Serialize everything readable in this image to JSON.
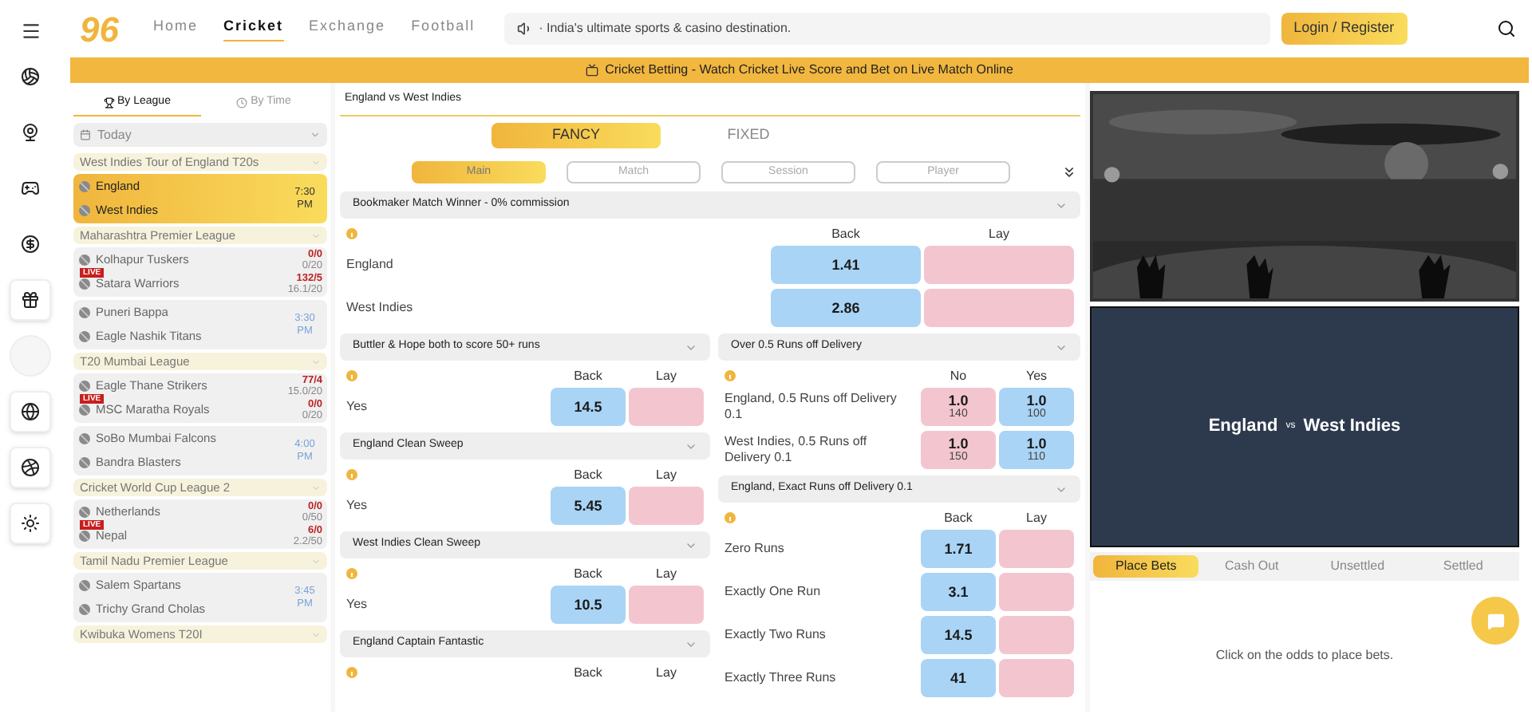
{
  "header": {
    "logo": "96",
    "nav": [
      {
        "label": "Home",
        "selected": false
      },
      {
        "label": "Cricket",
        "selected": true
      },
      {
        "label": "Exchange",
        "selected": false
      },
      {
        "label": "Football",
        "selected": false
      }
    ],
    "marquee": "· India's ultimate sports & casino destination.",
    "login_button": "Login / Register"
  },
  "banner": "Cricket Betting - Watch Cricket Live Score and Bet on Live Match Online",
  "match_list": {
    "tabs": [
      {
        "label": "By League",
        "selected": true
      },
      {
        "label": "By Time",
        "selected": false
      }
    ],
    "date_filter": "Today",
    "leagues": [
      {
        "name": "West Indies Tour of England T20s",
        "matches": [
          {
            "selected": true,
            "time": "7:30 PM",
            "teams": [
              {
                "name": "England"
              },
              {
                "name": "West Indies"
              }
            ]
          }
        ]
      },
      {
        "name": "Maharashtra Premier League",
        "matches": [
          {
            "selected": false,
            "badge": "LIVE",
            "teams": [
              {
                "name": "Kolhapur Tuskers",
                "score": "0/0",
                "overs": "0/20"
              },
              {
                "name": "Satara Warriors",
                "score": "132/5",
                "overs": "16.1/20"
              }
            ]
          },
          {
            "selected": false,
            "time": "3:30 PM",
            "teams": [
              {
                "name": "Puneri Bappa"
              },
              {
                "name": "Eagle Nashik Titans"
              }
            ]
          }
        ]
      },
      {
        "name": "T20 Mumbai League",
        "matches": [
          {
            "selected": false,
            "badge": "LIVE",
            "teams": [
              {
                "name": "Eagle Thane Strikers",
                "score": "77/4",
                "overs": "15.0/20"
              },
              {
                "name": "MSC Maratha Royals",
                "score": "0/0",
                "overs": "0/20"
              }
            ]
          },
          {
            "selected": false,
            "time": "4:00 PM",
            "teams": [
              {
                "name": "SoBo Mumbai Falcons"
              },
              {
                "name": "Bandra Blasters"
              }
            ]
          }
        ]
      },
      {
        "name": "Cricket World Cup League 2",
        "matches": [
          {
            "selected": false,
            "badge": "LIVE",
            "teams": [
              {
                "name": "Netherlands",
                "score": "0/0",
                "overs": "0/50"
              },
              {
                "name": "Nepal",
                "score": "6/0",
                "overs": "2.2/50"
              }
            ]
          }
        ]
      },
      {
        "name": "Tamil Nadu Premier League",
        "matches": [
          {
            "selected": false,
            "time": "3:45 PM",
            "teams": [
              {
                "name": "Salem Spartans"
              },
              {
                "name": "Trichy Grand Cholas"
              }
            ]
          }
        ]
      },
      {
        "name": "Kwibuka Womens T20I"
      }
    ]
  },
  "markets": {
    "title": "England vs West Indies",
    "main_tabs": [
      {
        "label": "FANCY",
        "selected": true
      },
      {
        "label": "FIXED",
        "selected": false
      }
    ],
    "sub_tabs": [
      {
        "label": "Main",
        "selected": true
      },
      {
        "label": "Match",
        "selected": false
      },
      {
        "label": "Session",
        "selected": false
      },
      {
        "label": "Player",
        "selected": false
      }
    ],
    "full_market": {
      "title": "Bookmaker Match Winner - 0% commission",
      "columns": [
        {
          "label": "Back",
          "kind": "back"
        },
        {
          "label": "Lay",
          "kind": "lay"
        }
      ],
      "runners": [
        {
          "name": "England",
          "back": {
            "price": "1.41"
          }
        },
        {
          "name": "West Indies",
          "back": {
            "price": "2.86"
          }
        }
      ]
    },
    "left_column": [
      {
        "title": "Buttler & Hope both to score 50+ runs",
        "columns": [
          {
            "label": "Back",
            "kind": "back"
          },
          {
            "label": "Lay",
            "kind": "lay"
          }
        ],
        "runners": [
          {
            "name": "Yes",
            "back": {
              "price": "14.5"
            }
          }
        ]
      },
      {
        "title": "England Clean Sweep",
        "columns": [
          {
            "label": "Back",
            "kind": "back"
          },
          {
            "label": "Lay",
            "kind": "lay"
          }
        ],
        "runners": [
          {
            "name": "Yes",
            "back": {
              "price": "5.45"
            }
          }
        ]
      },
      {
        "title": "West Indies Clean Sweep",
        "columns": [
          {
            "label": "Back",
            "kind": "back"
          },
          {
            "label": "Lay",
            "kind": "lay"
          }
        ],
        "runners": [
          {
            "name": "Yes",
            "back": {
              "price": "10.5"
            }
          }
        ]
      },
      {
        "title": "England Captain Fantastic",
        "columns": [
          {
            "label": "Back"
          },
          {
            "label": "Lay"
          }
        ]
      }
    ],
    "right_column": [
      {
        "title": "Over 0.5 Runs off Delivery",
        "columns": [
          {
            "label": "No",
            "kind": "lay"
          },
          {
            "label": "Yes",
            "kind": "back"
          }
        ],
        "runners": [
          {
            "name": "England, 0.5 Runs off Delivery 0.1",
            "lay": {
              "price": "1.0",
              "size": "140"
            },
            "back": {
              "price": "1.0",
              "size": "100"
            }
          },
          {
            "name": "West Indies, 0.5 Runs off Delivery 0.1",
            "lay": {
              "price": "1.0",
              "size": "150"
            },
            "back": {
              "price": "1.0",
              "size": "110"
            }
          }
        ]
      },
      {
        "title": "England, Exact Runs off Delivery 0.1",
        "columns": [
          {
            "label": "Back",
            "kind": "back"
          },
          {
            "label": "Lay",
            "kind": "lay"
          }
        ],
        "runners": [
          {
            "name": "Zero Runs",
            "back": {
              "price": "1.71"
            }
          },
          {
            "name": "Exactly One Run",
            "back": {
              "price": "3.1"
            }
          },
          {
            "name": "Exactly Two Runs",
            "back": {
              "price": "14.5"
            }
          },
          {
            "name": "Exactly Three Runs",
            "back": {
              "price": "41"
            }
          }
        ]
      }
    ]
  },
  "scoreboard": {
    "home": "England",
    "vs": "vs",
    "away": "West Indies"
  },
  "bet_slip": {
    "tabs": [
      {
        "label": "Place Bets",
        "selected": true
      },
      {
        "label": "Cash Out",
        "selected": false
      },
      {
        "label": "Unsettled",
        "selected": false
      },
      {
        "label": "Settled",
        "selected": false
      }
    ],
    "empty_message": "Click on the odds to place bets."
  }
}
